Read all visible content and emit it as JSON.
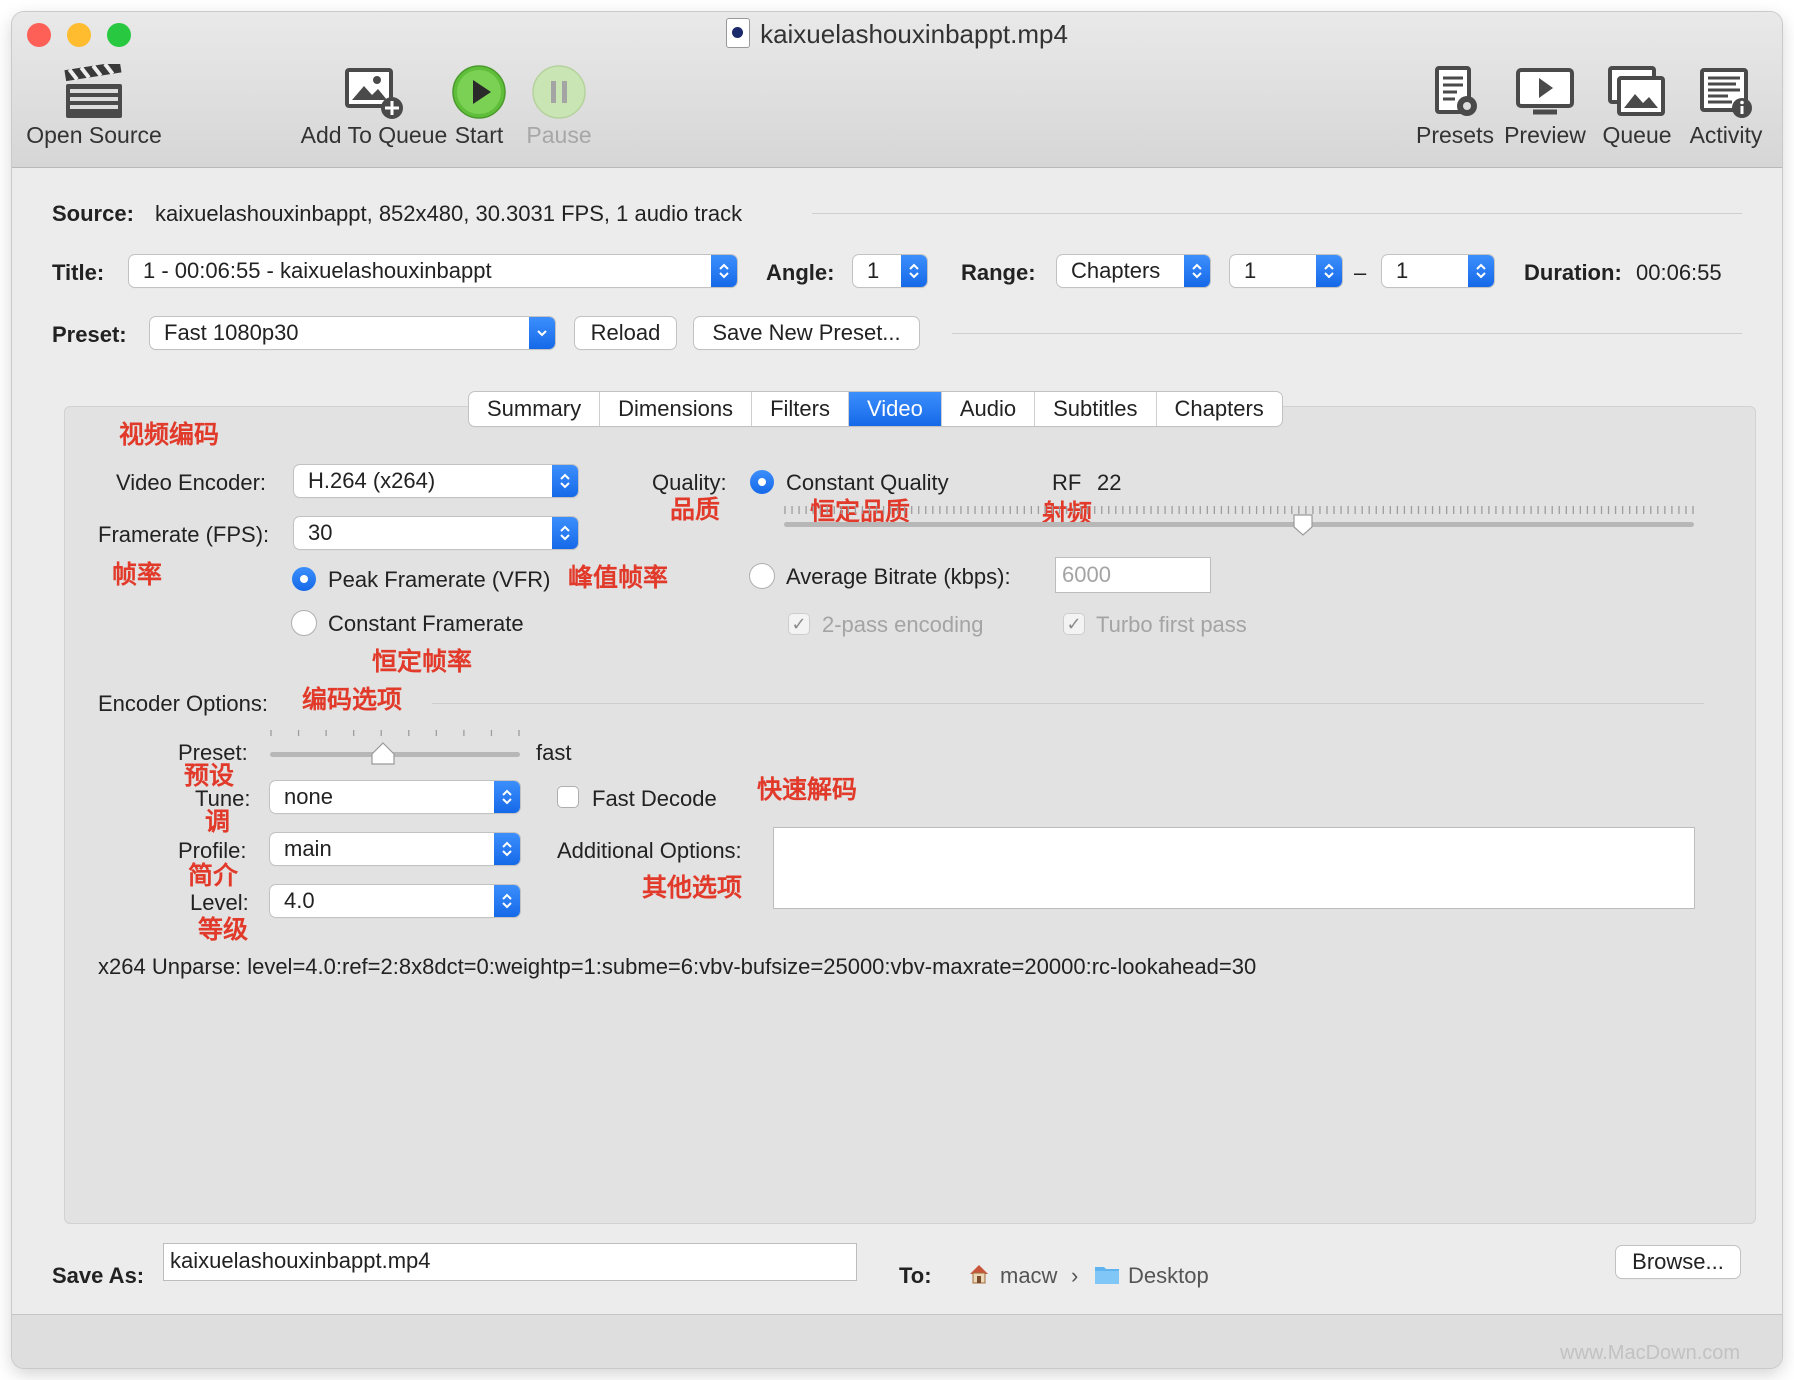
{
  "window": {
    "title": "kaixuelashouxinbappt.mp4",
    "traffic_colors": [
      "#fe5f57",
      "#febc2e",
      "#28c840"
    ]
  },
  "toolbar": {
    "open_source": "Open Source",
    "add_to_queue": "Add To Queue",
    "start": "Start",
    "pause": "Pause",
    "presets": "Presets",
    "preview": "Preview",
    "queue": "Queue",
    "activity": "Activity"
  },
  "source": {
    "label": "Source:",
    "value": "kaixuelashouxinbappt, 852x480, 30.3031 FPS, 1 audio track"
  },
  "title_row": {
    "title_label": "Title:",
    "title_value": "1 - 00:06:55 - kaixuelashouxinbappt",
    "angle_label": "Angle:",
    "angle_value": "1",
    "range_label": "Range:",
    "range_type": "Chapters",
    "range_start": "1",
    "range_dash": "–",
    "range_end": "1",
    "duration_label": "Duration:",
    "duration_value": "00:06:55"
  },
  "preset_row": {
    "label": "Preset:",
    "value": "Fast 1080p30",
    "reload": "Reload",
    "save_new": "Save New Preset..."
  },
  "tabs": [
    "Summary",
    "Dimensions",
    "Filters",
    "Video",
    "Audio",
    "Subtitles",
    "Chapters"
  ],
  "active_tab": "Video",
  "video": {
    "encoder_label": "Video Encoder:",
    "encoder_value": "H.264 (x264)",
    "framerate_label": "Framerate (FPS):",
    "framerate_value": "30",
    "peak_framerate": "Peak Framerate (VFR)",
    "constant_framerate": "Constant Framerate",
    "quality_label": "Quality:",
    "constant_quality": "Constant Quality",
    "rf_label": "RF",
    "rf_value": "22",
    "rf_slider_fraction": 0.57,
    "average_bitrate": "Average Bitrate (kbps):",
    "bitrate_placeholder": "6000",
    "two_pass": "2-pass encoding",
    "turbo_first_pass": "Turbo first pass"
  },
  "encoder_options": {
    "section_label": "Encoder Options:",
    "preset_label": "Preset:",
    "preset_value": "fast",
    "preset_slider_fraction": 0.45,
    "tune_label": "Tune:",
    "tune_value": "none",
    "fast_decode": "Fast Decode",
    "profile_label": "Profile:",
    "profile_value": "main",
    "additional_label": "Additional Options:",
    "level_label": "Level:",
    "level_value": "4.0",
    "unparse": "x264 Unparse: level=4.0:ref=2:8x8dct=0:weightp=1:subme=6:vbv-bufsize=25000:vbv-maxrate=20000:rc-lookahead=30"
  },
  "annotations": {
    "video_encoding": "视频编码",
    "framerate": "帧率",
    "peak_framerate": "峰值帧率",
    "constant_framerate": "恒定帧率",
    "quality": "品质",
    "constant_quality": "恒定品质",
    "rf": "射频",
    "encoder_options": "编码选项",
    "preset": "预设",
    "tune": "调",
    "profile": "简介",
    "level": "等级",
    "fast_decode": "快速解码",
    "additional_options": "其他选项"
  },
  "save": {
    "label": "Save As:",
    "value": "kaixuelashouxinbappt.mp4",
    "to_label": "To:",
    "path_home": "macw",
    "path_sep": "›",
    "path_folder": "Desktop",
    "browse": "Browse..."
  },
  "watermark": "www.MacDown.com"
}
